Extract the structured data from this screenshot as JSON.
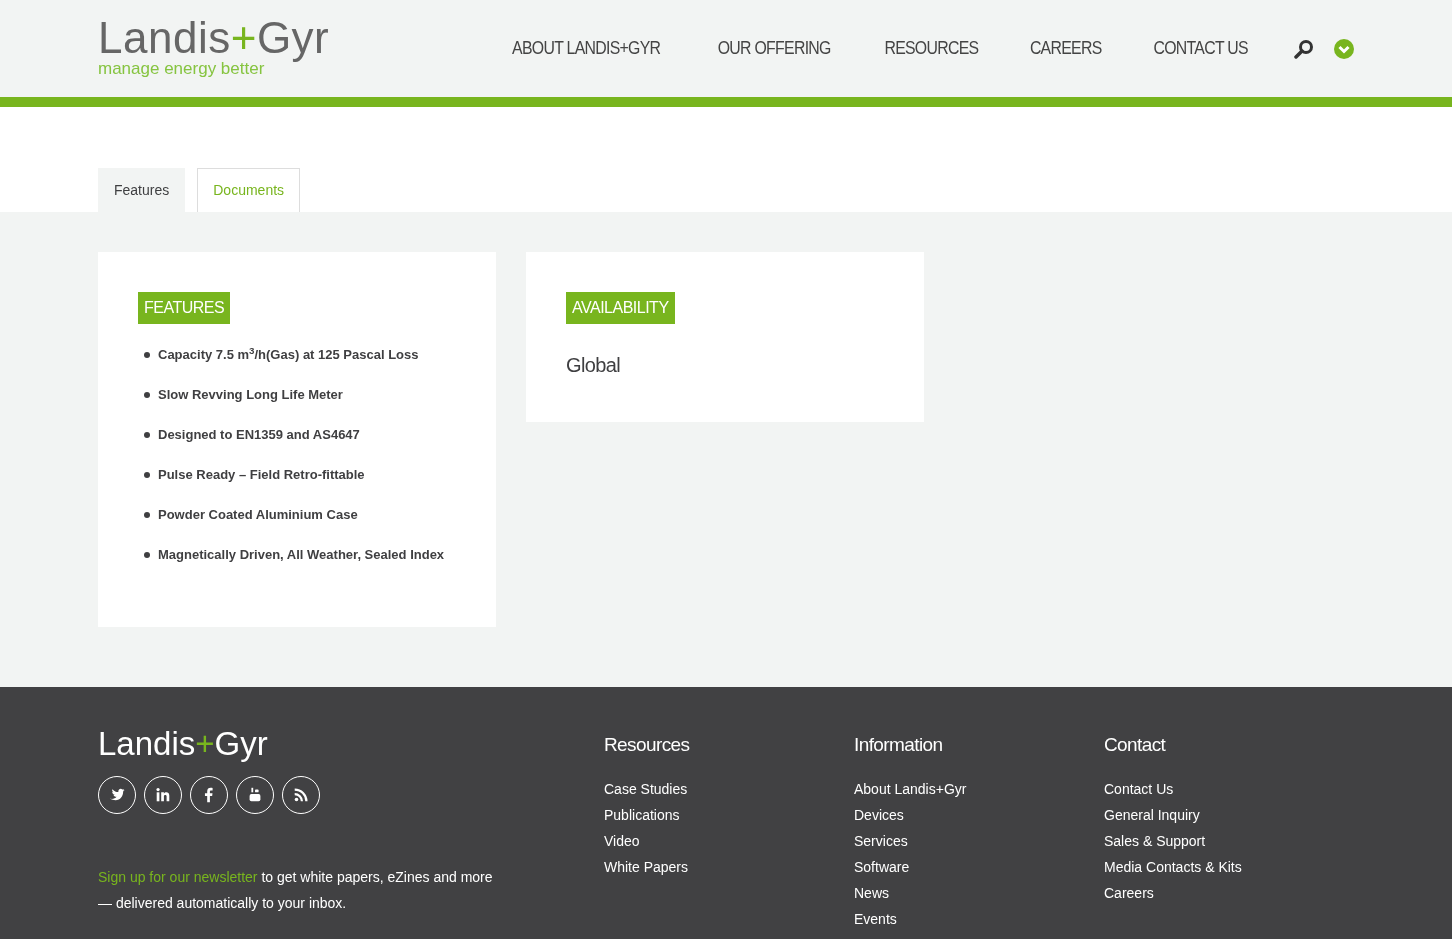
{
  "header": {
    "logo": {
      "word_left": "Landis",
      "plus": "+",
      "word_right": "Gyr",
      "tagline": "manage energy better"
    },
    "nav": [
      "ABOUT LANDIS+GYR",
      "OUR OFFERING",
      "RESOURCES",
      "CAREERS",
      "CONTACT US"
    ]
  },
  "tabs": [
    {
      "label": "Features",
      "selected": true
    },
    {
      "label": "Documents",
      "selected": false
    }
  ],
  "features": {
    "heading": "FEATURES",
    "items": [
      "Capacity 7.5 m$^{3}$/h(Gas) at 125 Pascal Loss",
      "Slow Revving Long Life Meter",
      "Designed to EN1359 and AS4647",
      "Pulse Ready – Field Retro-fittable",
      "Powder Coated Aluminium Case",
      "Magnetically Driven, All Weather, Sealed Index"
    ]
  },
  "availability": {
    "heading": "AVAILABILITY",
    "text": "Global"
  },
  "footer": {
    "logo": {
      "word_left": "Landis",
      "plus": "+",
      "word_right": "Gyr"
    },
    "social": [
      {
        "kind": "twitter"
      },
      {
        "kind": "linkedin"
      },
      {
        "kind": "facebook"
      },
      {
        "kind": "youtube"
      },
      {
        "kind": "rss"
      }
    ],
    "newsletter": {
      "link": "Sign up for our newsletter",
      "text": " to get white papers, eZines and more — delivered automatically to your inbox."
    },
    "columns": [
      {
        "title": "Resources",
        "links": [
          "Case Studies",
          "Publications",
          "Video",
          "White Papers"
        ]
      },
      {
        "title": "Information",
        "links": [
          "About Landis+Gyr",
          "Devices",
          "Services",
          "Software",
          "News",
          "Events"
        ]
      },
      {
        "title": "Contact",
        "links": [
          "Contact Us",
          "General Inquiry",
          "Sales & Support",
          "Media Contacts & Kits",
          "Careers"
        ]
      }
    ]
  }
}
